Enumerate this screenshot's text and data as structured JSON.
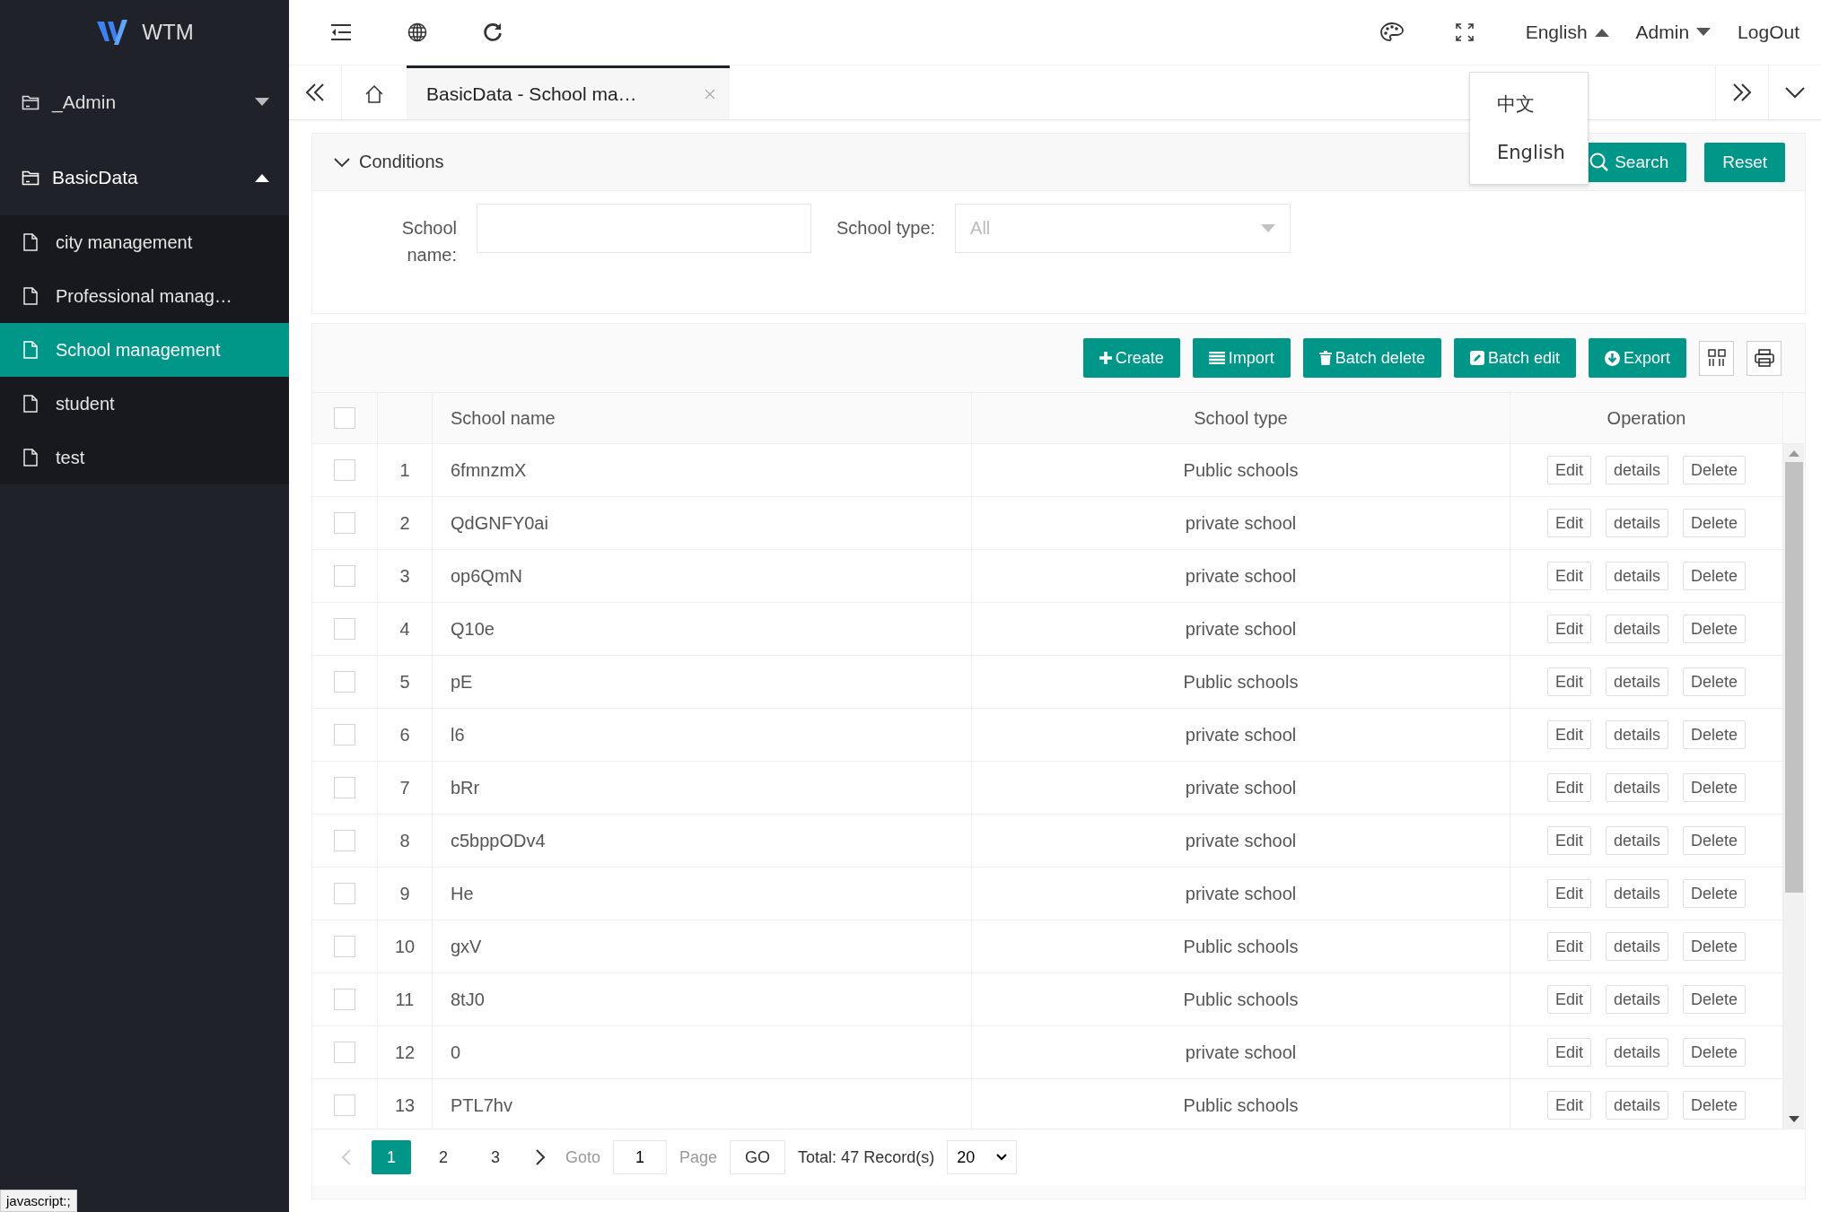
{
  "sidebar": {
    "logo": "WTM",
    "groups": [
      {
        "label": "_Admin",
        "expanded": false
      },
      {
        "label": "BasicData",
        "expanded": true,
        "children": [
          {
            "label": "city management",
            "selected": false
          },
          {
            "label": "Professional manag…",
            "selected": false
          },
          {
            "label": "School management",
            "selected": true
          },
          {
            "label": "student",
            "selected": false
          },
          {
            "label": "test",
            "selected": false
          }
        ]
      }
    ]
  },
  "topbar": {
    "language": {
      "label": "English",
      "expanded": true,
      "options": [
        "中文",
        "English"
      ]
    },
    "user": {
      "label": "Admin",
      "expanded": false
    },
    "logout": "LogOut"
  },
  "tabs": [
    {
      "kind": "home",
      "selected": false
    },
    {
      "kind": "page",
      "label": "BasicData - School ma…",
      "selected": true
    }
  ],
  "conditions": {
    "title": "Conditions",
    "expanded": true,
    "fields": [
      {
        "kind": "text",
        "label": "School name:"
      },
      {
        "kind": "select",
        "label": "School type:",
        "placeholder": "All"
      }
    ],
    "buttons": [
      "Search",
      "Reset"
    ]
  },
  "toolbar": {
    "buttons": [
      {
        "kind": "create",
        "label": "Create"
      },
      {
        "kind": "import",
        "label": "Import"
      },
      {
        "kind": "delete",
        "label": "Batch delete"
      },
      {
        "kind": "edit",
        "label": "Batch edit"
      },
      {
        "kind": "export",
        "label": "Export"
      }
    ]
  },
  "table": {
    "columns": [
      "School name",
      "School type",
      "Operation"
    ],
    "header_checked": false,
    "rows": [
      {
        "index": "1",
        "name": "6fmnzmX",
        "type": "Public schools",
        "checked": false,
        "actions": [
          "Edit",
          "details",
          "Delete"
        ]
      },
      {
        "index": "2",
        "name": "QdGNFY0ai",
        "type": "private school",
        "checked": false,
        "actions": [
          "Edit",
          "details",
          "Delete"
        ]
      },
      {
        "index": "3",
        "name": "op6QmN",
        "type": "private school",
        "checked": false,
        "actions": [
          "Edit",
          "details",
          "Delete"
        ]
      },
      {
        "index": "4",
        "name": "Q10e",
        "type": "private school",
        "checked": false,
        "actions": [
          "Edit",
          "details",
          "Delete"
        ]
      },
      {
        "index": "5",
        "name": "pE",
        "type": "Public schools",
        "checked": false,
        "actions": [
          "Edit",
          "details",
          "Delete"
        ]
      },
      {
        "index": "6",
        "name": "l6",
        "type": "private school",
        "checked": false,
        "actions": [
          "Edit",
          "details",
          "Delete"
        ]
      },
      {
        "index": "7",
        "name": "bRr",
        "type": "private school",
        "checked": false,
        "actions": [
          "Edit",
          "details",
          "Delete"
        ]
      },
      {
        "index": "8",
        "name": "c5bppODv4",
        "type": "private school",
        "checked": false,
        "actions": [
          "Edit",
          "details",
          "Delete"
        ]
      },
      {
        "index": "9",
        "name": "He",
        "type": "private school",
        "checked": false,
        "actions": [
          "Edit",
          "details",
          "Delete"
        ]
      },
      {
        "index": "10",
        "name": "gxV",
        "type": "Public schools",
        "checked": false,
        "actions": [
          "Edit",
          "details",
          "Delete"
        ]
      },
      {
        "index": "11",
        "name": "8tJ0",
        "type": "Public schools",
        "checked": false,
        "actions": [
          "Edit",
          "details",
          "Delete"
        ]
      },
      {
        "index": "12",
        "name": "0",
        "type": "private school",
        "checked": false,
        "actions": [
          "Edit",
          "details",
          "Delete"
        ]
      },
      {
        "index": "13",
        "name": "PTL7hv",
        "type": "Public schools",
        "checked": false,
        "actions": [
          "Edit",
          "details",
          "Delete"
        ]
      }
    ]
  },
  "pagination": {
    "prev_disabled": true,
    "pages": [
      {
        "label": "1",
        "selected": true
      },
      {
        "label": "2",
        "selected": false
      },
      {
        "label": "3",
        "selected": false
      }
    ],
    "goto": "Goto",
    "goto_value": "1",
    "page": "Page",
    "go": "GO",
    "total": "Total: 47 Record(s)",
    "page_size": "20"
  },
  "status_bar": "javascript:;"
}
